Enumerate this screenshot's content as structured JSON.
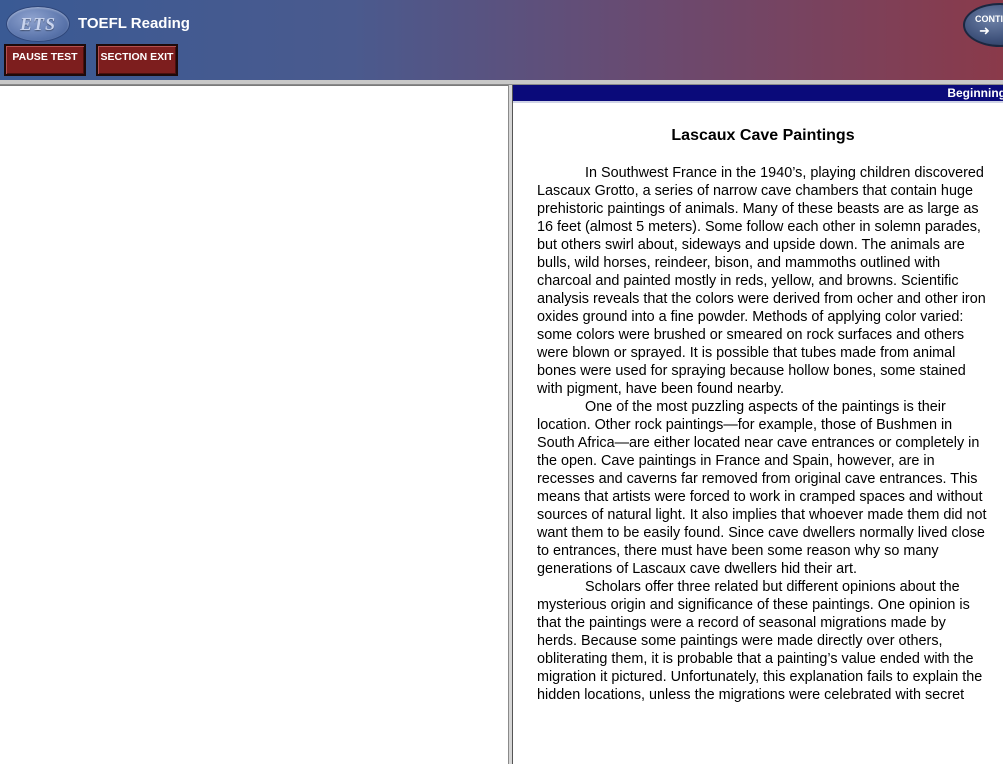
{
  "header": {
    "logo_text": "ETS",
    "app_title": "TOEFL Reading",
    "pause_button": "PAUSE TEST",
    "section_exit_button": "SECTION EXIT",
    "continue_button": "CONTINUE",
    "continue_visible_label": "CONTI"
  },
  "position_indicator": "Beginning",
  "passage": {
    "title": "Lascaux Cave Paintings",
    "paragraphs": [
      "In Southwest France in the 1940’s, playing children discovered Lascaux Grotto, a series of narrow cave chambers that contain huge prehistoric paintings of animals. Many of these beasts are as large as 16 feet (almost 5 meters). Some follow each other in solemn parades, but others swirl about, sideways and upside down. The animals are bulls, wild horses, reindeer, bison, and mammoths outlined with charcoal and painted mostly in reds, yellow, and browns. Scientific analysis reveals that the colors were derived from ocher and other iron oxides ground into a fine powder. Methods of applying color varied: some colors were brushed or smeared on rock surfaces and others were blown or sprayed. It is possible that tubes made from animal bones were used for spraying because hollow bones, some stained with pigment, have been found nearby.",
      "One of the most puzzling aspects of the paintings is their location. Other rock paintings—for example, those of Bushmen in South Africa—are either located near cave entrances or completely in the open.  Cave paintings in France and Spain, however, are in recesses and caverns far removed from original cave entrances.  This means that artists were forced to work in cramped spaces and without sources of natural light.  It also implies that whoever made them did not want them to be easily found.  Since cave dwellers normally lived close to entrances, there must have been some reason why so many generations of Lascaux cave dwellers hid their art.",
      "Scholars offer three related but different opinions about the mysterious origin and significance of these paintings. One opinion is that the paintings were a record of seasonal migrations made by herds. Because some paintings were made directly over others, obliterating them, it is probable that a painting’s value ended with the migration it pictured. Unfortunately, this explanation fails to explain the hidden locations, unless the migrations were celebrated with secret"
    ]
  },
  "colors": {
    "header_left": "#3a5a94",
    "header_right": "#8a3a4a",
    "button_red": "#7d1e1e",
    "position_bar": "#0a0a7a"
  }
}
